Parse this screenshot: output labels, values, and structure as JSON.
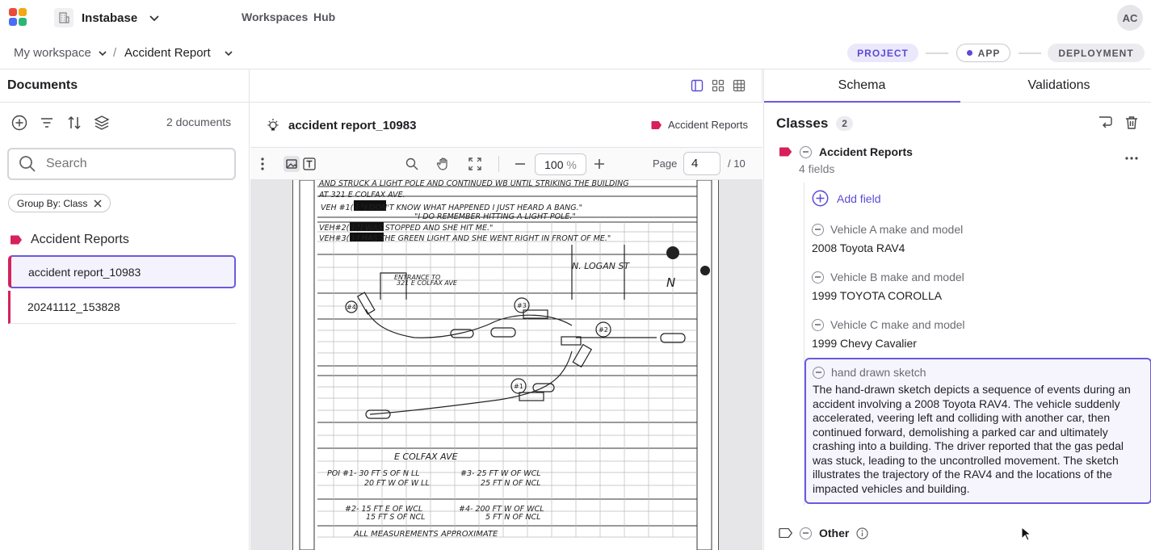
{
  "app": {
    "org_name": "Instabase",
    "user_initials": "AC"
  },
  "nav": {
    "workspaces": "Workspaces",
    "hub": "Hub"
  },
  "breadcrumb": {
    "workspace": "My workspace",
    "separator": "/",
    "project": "Accident Report"
  },
  "pipeline": {
    "project": "PROJECT",
    "app": "APP",
    "deployment": "DEPLOYMENT"
  },
  "documents": {
    "title": "Documents",
    "count": "2 documents",
    "search_placeholder": "Search",
    "group_chip": "Group By: Class",
    "group_name": "Accident Reports",
    "items": [
      {
        "name": "accident report_10983"
      },
      {
        "name": "20241112_153828"
      }
    ]
  },
  "viewer": {
    "doc_title": "accident report_10983",
    "class_tag": "Accident Reports",
    "zoom": "100",
    "zoom_unit": "%",
    "page_label": "Page",
    "page_current": "4",
    "page_total": "/ 10",
    "sketch": {
      "lines": [
        "AND STRUCK A LIGHT POLE AND CONTINUED WB UNTIL STRIKING THE BUILDING",
        "AT 321 E COLFAX AVE.",
        "VEH #1(        ) \"I DON'T KNOW WHAT HAPPENED I JUST HEARD A BANG.\"",
        "\"I DO REMEMBER HITTING A LIGHT POLE.\"",
        "VEH#2(        ) \"I WAS STOPPED AND SHE HIT ME.\"",
        "VEH#3(        ) I HAS THE GREEN LIGHT AND SHE WENT RIGHT IN FRONT OF ME.\""
      ],
      "street_n": "N. LOGAN ST",
      "north": "N",
      "entrance": "ENTRANCE TO",
      "entrance_addr": "321 E COLFAX AVE",
      "street_e": "E  COLFAX AVE",
      "poi_1a": "POI #1- 30 FT S OF N LL",
      "poi_1b": "20 FT W OF W LL",
      "poi_3a": "#3- 25 FT W OF WCL",
      "poi_3b": "25 FT N OF NCL",
      "poi_2a": "#2- 15 FT E OF WCL",
      "poi_2b": "15 FT S OF NCL",
      "poi_4a": "#4- 200 FT W OF WCL",
      "poi_4b": "5 FT N OF NCL",
      "footer": "ALL MEASUREMENTS APPROXIMATE",
      "labels": {
        "v1": "#1",
        "v2": "#2",
        "v3": "#3",
        "v4": "#4"
      }
    }
  },
  "panel": {
    "tab_schema": "Schema",
    "tab_validations": "Validations",
    "classes_title": "Classes",
    "classes_count": "2",
    "class_name": "Accident Reports",
    "class_fields": "4 fields",
    "add_field": "Add field",
    "fields": [
      {
        "label": "Vehicle A make and model",
        "value": "2008 Toyota RAV4"
      },
      {
        "label": "Vehicle B make and model",
        "value": "1999 TOYOTA COROLLA"
      },
      {
        "label": "Vehicle C make and model",
        "value": "1999 Chevy Cavalier"
      },
      {
        "label": "hand drawn sketch",
        "value": "The hand-drawn sketch depicts a sequence of events during an accident involving a 2008 Toyota RAV4. The vehicle suddenly accelerated, veering left and colliding with another car, then continued forward, demolishing a parked car and ultimately crashing into a building. The driver reported that the gas pedal was stuck, leading to the uncontrolled movement. The sketch illustrates the trajectory of the RAV4 and the locations of the impacted vehicles and building."
      }
    ],
    "other_class": "Other"
  },
  "colors": {
    "accent": "#6a5ae0",
    "tag": "#d6215a"
  }
}
